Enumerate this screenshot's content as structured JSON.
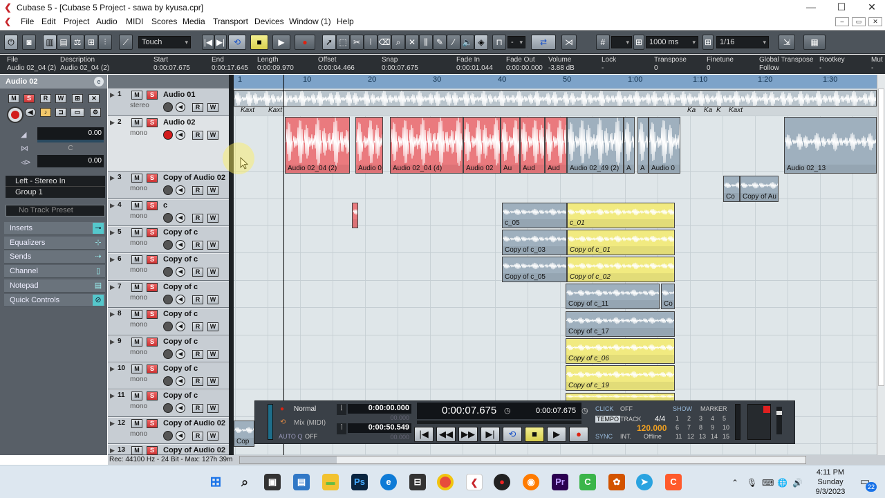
{
  "window": {
    "title": "Cubase 5 - [Cubase 5 Project - sawa by kyusa.cpr]",
    "minimize": "—",
    "maximize": "☐",
    "close": "✕"
  },
  "menu": [
    "File",
    "Edit",
    "Project",
    "Audio",
    "MIDI",
    "Scores",
    "Media",
    "Transport",
    "Devices",
    "Window (1)",
    "Help"
  ],
  "toolbar": {
    "automation_mode": "Touch",
    "nudge_value": "-",
    "grid_type": "1000 ms",
    "quantize": "1/16"
  },
  "infoline": {
    "headers": [
      "File",
      "Description",
      "Start",
      "End",
      "Length",
      "Offset",
      "Snap",
      "Fade In",
      "Fade Out",
      "Volume",
      "Lock",
      "Transpose",
      "Finetune",
      "Global Transpose",
      "Rootkey",
      "Mut"
    ],
    "values": [
      "Audio 02_04 (2)",
      "Audio 02_04 (2)",
      "0:00:07.675",
      "0:00:17.645",
      "0:00:09.970",
      "0:00:04.466",
      "0:00:07.675",
      "0:00:01.044",
      "0:00:00.000",
      "-3.88 dB",
      "-",
      "0",
      "0",
      "Follow",
      "-",
      "-"
    ]
  },
  "inspector": {
    "track_name": "Audio 02",
    "volume_value": "0.00",
    "pan_label": "C",
    "pan_value": "0.00",
    "input_routing": "Left - Stereo In",
    "output_routing": "Group 1",
    "track_preset_placeholder": "No Track Preset",
    "sections": [
      "Inserts",
      "Equalizers",
      "Sends",
      "Channel",
      "Notepad",
      "Quick Controls"
    ]
  },
  "tracks": [
    {
      "num": "1",
      "name": "Audio 01",
      "sub": "stereo"
    },
    {
      "num": "2",
      "name": "Audio 02",
      "sub": "mono"
    },
    {
      "num": "3",
      "name": "Copy of Audio 02",
      "sub": "mono"
    },
    {
      "num": "4",
      "name": "c",
      "sub": "mono"
    },
    {
      "num": "5",
      "name": "Copy of c",
      "sub": "mono"
    },
    {
      "num": "6",
      "name": "Copy of c",
      "sub": "mono"
    },
    {
      "num": "7",
      "name": "Copy of c",
      "sub": "mono"
    },
    {
      "num": "8",
      "name": "Copy of c",
      "sub": "mono"
    },
    {
      "num": "9",
      "name": "Copy of c",
      "sub": "mono"
    },
    {
      "num": "10",
      "name": "Copy of c",
      "sub": "mono"
    },
    {
      "num": "11",
      "name": "Copy of c",
      "sub": "mono"
    },
    {
      "num": "12",
      "name": "Copy of Audio 02",
      "sub": "mono"
    },
    {
      "num": "13",
      "name": "Copy of Audio 02",
      "sub": ""
    }
  ],
  "ruler": [
    "1",
    "10",
    "20",
    "30",
    "40",
    "50",
    "1:00",
    "1:10",
    "1:20",
    "1:30"
  ],
  "markers": [
    "Kaxt",
    "Kaxt",
    "Ka",
    "Ka",
    "K",
    "Kaxt"
  ],
  "events": {
    "t2": [
      "Audio 02_04 (2)",
      "Audio 0",
      "Audio 02_04 (4)",
      "Audio 02",
      "Au",
      "Aud",
      "Aud",
      "Audio 02_49 (2)",
      "A",
      "A",
      "Audio 0",
      "Audio 02_13"
    ],
    "t3": [
      "Co",
      "Copy of Au"
    ],
    "t4": [
      "c_05",
      "c_01"
    ],
    "t5": [
      "Copy of c_03",
      "Copy of c_01"
    ],
    "t6": [
      "Copy of c_05",
      "Copy of c_02"
    ],
    "t7": [
      "Copy of c_11",
      "Co"
    ],
    "t8": [
      "Copy of c_17"
    ],
    "t9": [
      "Copy of c_06"
    ],
    "t10": [
      "Copy of c_19"
    ],
    "t12": [
      "Cop"
    ]
  },
  "statusbar": "Rec: 44100 Hz - 24 Bit - Max: 127h 39m",
  "transport": {
    "mode": "Normal",
    "mix": "Mix (MIDI)",
    "auto_q": "AUTO Q",
    "auto_q_state": "OFF",
    "left_locator": "0:00:00.000",
    "left_sub": "00.000",
    "right_locator": "0:00:50.549",
    "right_sub": "00.000",
    "primary_time": "0:00:07.675",
    "secondary_time": "0:00:07.675",
    "click": "CLICK",
    "click_state": "OFF",
    "tempo": "TEMPO",
    "track": "TRACK",
    "signature": "4/4",
    "tempo_value": "120.000",
    "sync": "SYNC",
    "sync_int": "INT.",
    "sync_state": "Offline",
    "show": "SHOW",
    "marker": "MARKER",
    "marker_numbers": [
      "1",
      "2",
      "3",
      "4",
      "5",
      "6",
      "7",
      "8",
      "9",
      "10",
      "11",
      "12",
      "13",
      "14",
      "15"
    ]
  },
  "clock": {
    "time": "4:11 PM",
    "day": "Sunday",
    "date": "9/3/2023"
  },
  "taskbar_badge": "22"
}
